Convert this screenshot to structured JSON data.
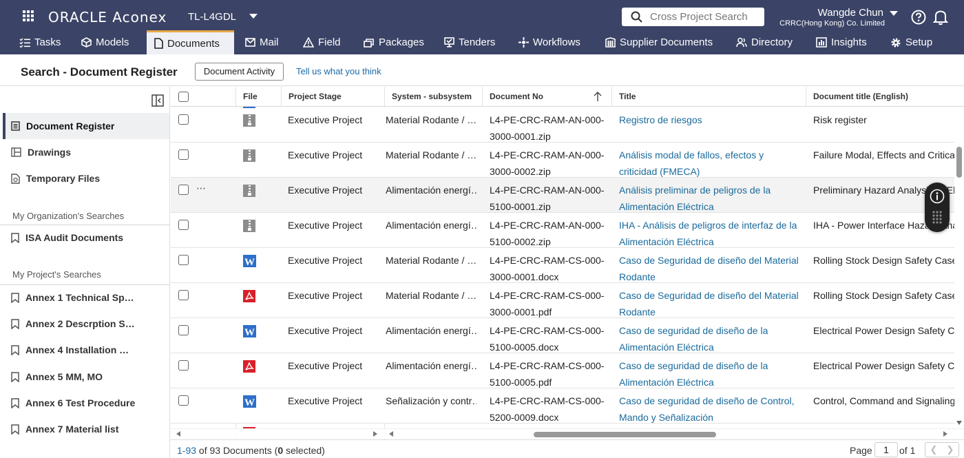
{
  "app": {
    "logo": "ORACLE Aconex",
    "project": "TL-L4GDL"
  },
  "search": {
    "placeholder": "Cross Project Search"
  },
  "user": {
    "name": "Wangde Chun",
    "org": "CRRC(Hong Kong) Co. Limited"
  },
  "nav": [
    {
      "label": "Tasks",
      "icon": "tasks-icon"
    },
    {
      "label": "Models",
      "icon": "models-icon"
    },
    {
      "label": "Documents",
      "icon": "documents-icon"
    },
    {
      "label": "Mail",
      "icon": "mail-icon"
    },
    {
      "label": "Field",
      "icon": "field-icon"
    },
    {
      "label": "Packages",
      "icon": "packages-icon"
    },
    {
      "label": "Tenders",
      "icon": "tenders-icon"
    },
    {
      "label": "Workflows",
      "icon": "workflows-icon"
    },
    {
      "label": "Supplier Documents",
      "icon": "supplier-documents-icon"
    },
    {
      "label": "Directory",
      "icon": "directory-icon"
    },
    {
      "label": "Insights",
      "icon": "insights-icon"
    },
    {
      "label": "Setup",
      "icon": "setup-icon"
    }
  ],
  "page": {
    "title": "Search - Document Register",
    "activity_button": "Document Activity",
    "feedback_link": "Tell us what you think"
  },
  "sidebar": {
    "items": [
      {
        "label": "Document Register",
        "icon": "register-icon"
      },
      {
        "label": "Drawings",
        "icon": "drawings-icon"
      },
      {
        "label": "Temporary Files",
        "icon": "temporary-files-icon"
      }
    ],
    "org_section": "My Organization's Searches",
    "org_searches": [
      "ISA Audit Documents"
    ],
    "project_section": "My Project's Searches",
    "project_searches": [
      "Annex 1 Technical Sp…",
      "Annex 2 Descrption S…",
      "Annex 4 Installation …",
      "Annex 5 MM, MO",
      "Annex 6 Test Procedure",
      "Annex 7 Material list"
    ]
  },
  "table": {
    "columns": [
      "File",
      "Project Stage",
      "System - subsystem",
      "Document No",
      "Title",
      "Document title (English)"
    ],
    "rows": [
      {
        "file": "zip",
        "stage": "Executive Project",
        "system": "Material Rodante / …",
        "docno": "L4-PE-CRC-RAM-AN-000-3000-0001.zip",
        "title": "Registro de riesgos",
        "title_en": "Risk register"
      },
      {
        "file": "zip",
        "stage": "Executive Project",
        "system": "Material Rodante / …",
        "docno": "L4-PE-CRC-RAM-AN-000-3000-0002.zip",
        "title": "Análisis modal de fallos, efectos y criticidad (FMECA)",
        "title_en": "Failure Modal, Effects and Criticality"
      },
      {
        "file": "zip",
        "stage": "Executive Project",
        "system": "Alimentación energí…",
        "docno": "L4-PE-CRC-RAM-AN-000-5100-0001.zip",
        "title": "Análisis preliminar de peligros de la Alimentación Eléctrica",
        "title_en": "Preliminary Hazard Analysis of Elect",
        "highlighted": true
      },
      {
        "file": "zip",
        "stage": "Executive Project",
        "system": "Alimentación energí…",
        "docno": "L4-PE-CRC-RAM-AN-000-5100-0002.zip",
        "title": "IHA - Análisis de peligros de interfaz de la Alimentación Eléctrica",
        "title_en": "IHA - Power Interface Hazard Analy"
      },
      {
        "file": "docx",
        "stage": "Executive Project",
        "system": "Material Rodante / …",
        "docno": "L4-PE-CRC-RAM-CS-000-3000-0001.docx",
        "title": "Caso de Seguridad de diseño del Material Rodante",
        "title_en": "Rolling Stock Design Safety Case"
      },
      {
        "file": "pdf",
        "stage": "Executive Project",
        "system": "Material Rodante / …",
        "docno": "L4-PE-CRC-RAM-CS-000-3000-0001.pdf",
        "title": "Caso de Seguridad de diseño del Material Rodante",
        "title_en": "Rolling Stock Design Safety Case"
      },
      {
        "file": "docx",
        "stage": "Executive Project",
        "system": "Alimentación energí…",
        "docno": "L4-PE-CRC-RAM-CS-000-5100-0005.docx",
        "title": "Caso de seguridad de diseño de la Alimentación Eléctrica",
        "title_en": "Electrical Power Design Safety Case"
      },
      {
        "file": "pdf",
        "stage": "Executive Project",
        "system": "Alimentación energí…",
        "docno": "L4-PE-CRC-RAM-CS-000-5100-0005.pdf",
        "title": "Caso de seguridad de diseño de la Alimentación Eléctrica",
        "title_en": "Electrical Power Design Safety Case"
      },
      {
        "file": "docx",
        "stage": "Executive Project",
        "system": "Señalización y contr…",
        "docno": "L4-PE-CRC-RAM-CS-000-5200-0009.docx",
        "title": "Caso de seguridad de diseño de Control, Mando y Señalización",
        "title_en": "Control, Command and Signaling d"
      }
    ]
  },
  "footer": {
    "range": "1-93",
    "of_text": "of 93 Documents",
    "selected_open": "(",
    "selected_count": "0",
    "selected_close": " selected)",
    "page_label": "Page",
    "page_value": "1",
    "page_of": "of 1"
  },
  "colors": {
    "topbar": "#3b4466",
    "accent": "#e8a94a",
    "link": "#1a6a9a"
  }
}
